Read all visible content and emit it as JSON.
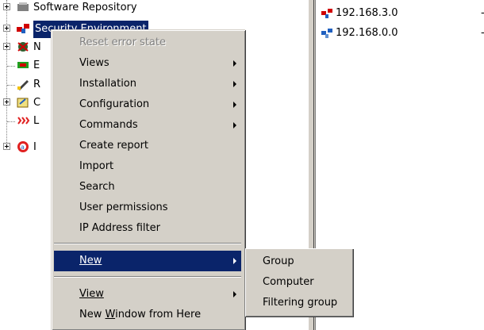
{
  "tree": {
    "items": [
      {
        "label": "Software Repository",
        "icon": "software-repository-icon"
      },
      {
        "label": "Security Environment",
        "icon": "security-environment-icon"
      },
      {
        "label": "N",
        "icon": "network-icon"
      },
      {
        "label": "E",
        "icon": "event-icon"
      },
      {
        "label": "R",
        "icon": "report-icon"
      },
      {
        "label": "C",
        "icon": "configuration-icon"
      },
      {
        "label": "L",
        "icon": "log-icon"
      },
      {
        "label": "I",
        "icon": "info-icon"
      }
    ]
  },
  "list": {
    "rows": [
      {
        "label": "192.168.3.0",
        "value": "-",
        "icon": "network-red-icon"
      },
      {
        "label": "192.168.0.0",
        "value": "-",
        "icon": "network-blue-icon"
      }
    ]
  },
  "context_menu": {
    "items": [
      {
        "label": "Reset error state",
        "disabled": true,
        "submenu": false
      },
      {
        "label": "Views",
        "submenu": true
      },
      {
        "label": "Installation",
        "submenu": true
      },
      {
        "label": "Configuration",
        "submenu": true
      },
      {
        "label": "Commands",
        "submenu": true
      },
      {
        "label": "Create report",
        "submenu": false
      },
      {
        "label": "Import",
        "submenu": false
      },
      {
        "label": "Search",
        "submenu": false
      },
      {
        "label": "User permissions",
        "submenu": false
      },
      {
        "label": "IP Address filter",
        "submenu": false
      }
    ],
    "new_label": "New",
    "view_label": "View",
    "new_window_label_pre": "New ",
    "new_window_label_u": "W",
    "new_window_label_post": "indow from Here"
  },
  "submenu": {
    "items": [
      "Group",
      "Computer",
      "Filtering group"
    ]
  },
  "colors": {
    "highlight": "#0a246a",
    "menu_bg": "#d4d0c8"
  }
}
